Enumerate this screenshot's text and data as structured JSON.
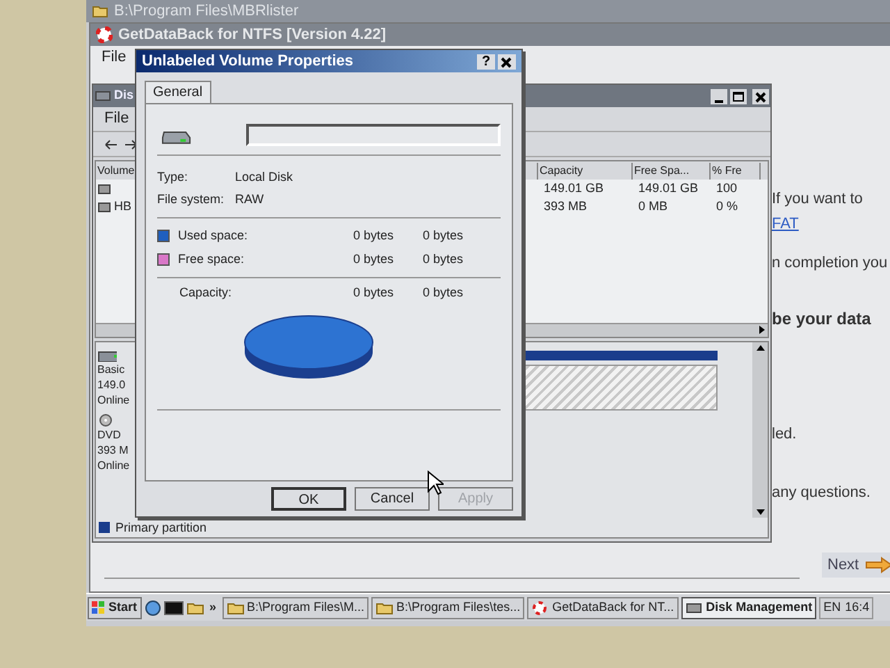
{
  "background_window": {
    "title": "B:\\Program Files\\MBRlister"
  },
  "getdataback": {
    "title": "GetDataBack for NTFS [Version 4.22]",
    "menu": [
      "File"
    ],
    "texts": [
      {
        "kind": "plain",
        "text": "If you want to"
      },
      {
        "kind": "link",
        "text": "FAT"
      },
      {
        "kind": "plain",
        "text": "n completion you"
      },
      {
        "kind": "bold",
        "text": "be your data"
      },
      {
        "kind": "plain",
        "text": "led."
      },
      {
        "kind": "plain",
        "text": "any questions."
      }
    ],
    "next_button": "Next"
  },
  "disk_management": {
    "title": "Dis",
    "menu": [
      "File"
    ],
    "columns": [
      "Volume",
      "Capacity",
      "Free Spa...",
      "% Fre"
    ],
    "rows": [
      {
        "capacity": "149.01 GB",
        "free": "149.01 GB",
        "percent": "100"
      },
      {
        "volume": "HB",
        "capacity": "393 MB",
        "free": "0 MB",
        "percent": "0 %"
      }
    ],
    "disks": [
      {
        "kind": "disk",
        "lines": [
          "Basic",
          "149.0",
          "Online"
        ]
      },
      {
        "kind": "dvd",
        "lines": [
          "DVD",
          "393 M",
          "Online"
        ]
      }
    ],
    "legend": "Primary partition"
  },
  "dialog": {
    "title": "Unlabeled Volume Properties",
    "help": "?",
    "tabs": [
      {
        "label": "General",
        "selected": true
      }
    ],
    "info": [
      {
        "label": "Type:",
        "value": "Local Disk"
      },
      {
        "label": "File system:",
        "value": "RAW"
      }
    ],
    "space": [
      {
        "label": "Used space:",
        "color": "#1f5fbf",
        "bytes": "0 bytes",
        "size": "0 bytes"
      },
      {
        "label": "Free space:",
        "color": "#d977c8",
        "bytes": "0 bytes",
        "size": "0 bytes"
      }
    ],
    "capacity": {
      "label": "Capacity:",
      "bytes": "0 bytes",
      "size": "0 bytes"
    },
    "buttons": [
      {
        "label": "OK",
        "disabled": false,
        "default": true
      },
      {
        "label": "Cancel",
        "disabled": false,
        "default": false
      },
      {
        "label": "Apply",
        "disabled": true,
        "default": false
      }
    ]
  },
  "taskbar": {
    "start": "Start",
    "more": "»",
    "tasks": [
      {
        "label": "B:\\Program Files\\M...",
        "kind": "folder",
        "selected": false
      },
      {
        "label": "B:\\Program Files\\tes...",
        "kind": "folder",
        "selected": false
      },
      {
        "label": "GetDataBack for NT...",
        "kind": "app",
        "selected": false
      },
      {
        "label": "Disk Management",
        "kind": "disk",
        "selected": true
      }
    ],
    "language": "EN",
    "clock": "16:4"
  }
}
